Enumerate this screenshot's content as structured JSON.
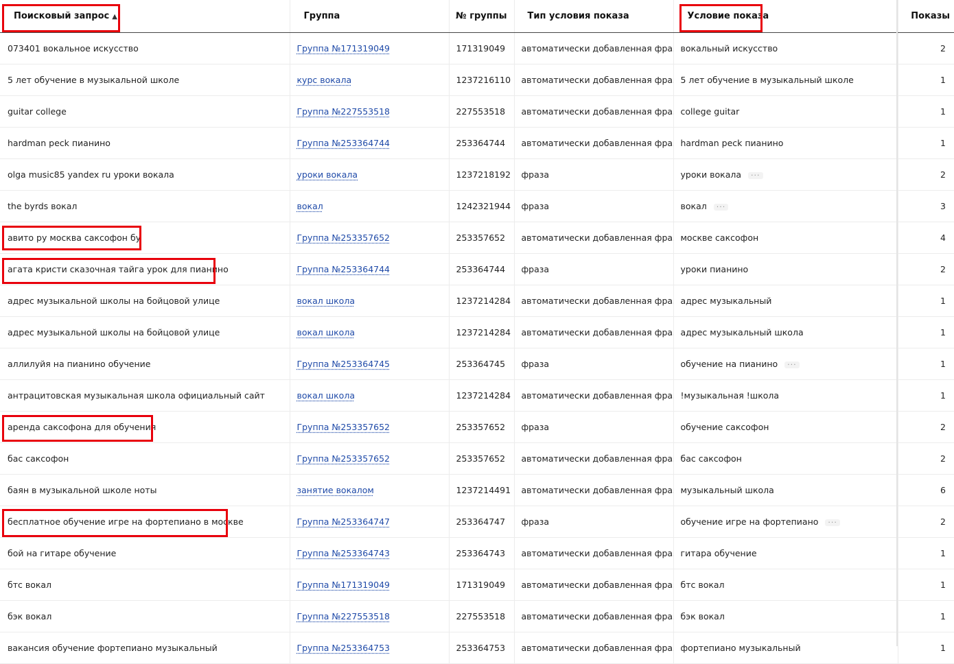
{
  "header": {
    "query": "Поисковый запрос",
    "sort_arrow": "▲",
    "group": "Группа",
    "group_number": "№ группы",
    "condition_type": "Тип условия показа",
    "condition": "Условие показа",
    "shows": "Показы"
  },
  "rows": [
    {
      "query": "073401 вокальное искусство",
      "group": "Группа №171319049",
      "group_number": "171319049",
      "type": "автоматически добавленная фраза",
      "condition": "вокальный искусство",
      "more": "",
      "shows": "2"
    },
    {
      "query": "5 лет обучение в музыкальной школе",
      "group": "курс вокала",
      "group_number": "1237216110",
      "type": "автоматически добавленная фраза",
      "condition": "5 лет обучение в музыкальный школе",
      "more": "",
      "shows": "1"
    },
    {
      "query": "guitar college",
      "group": "Группа №227553518",
      "group_number": "227553518",
      "type": "автоматически добавленная фраза",
      "condition": "college guitar",
      "more": "",
      "shows": "1"
    },
    {
      "query": "hardman peck пианино",
      "group": "Группа №253364744",
      "group_number": "253364744",
      "type": "автоматически добавленная фраза",
      "condition": "hardman peck пианино",
      "more": "",
      "shows": "1"
    },
    {
      "query": "olga music85 yandex ru уроки вокала",
      "group": "уроки вокала",
      "group_number": "1237218192",
      "type": "фраза",
      "condition": "уроки вокала",
      "more": "···",
      "shows": "2"
    },
    {
      "query": "the byrds вокал",
      "group": "вокал",
      "group_number": "1242321944",
      "type": "фраза",
      "condition": "вокал",
      "more": "···",
      "shows": "3"
    },
    {
      "query": "авито ру москва саксофон бу",
      "group": "Группа №253357652",
      "group_number": "253357652",
      "type": "автоматически добавленная фраза",
      "condition": "москве саксофон",
      "more": "",
      "shows": "4"
    },
    {
      "query": "агата кристи сказочная тайга урок для пианино",
      "group": "Группа №253364744",
      "group_number": "253364744",
      "type": "фраза",
      "condition": "уроки пианино",
      "more": "",
      "shows": "2"
    },
    {
      "query": "адрес музыкальной школы на бойцовой улице",
      "group": "вокал школа",
      "group_number": "1237214284",
      "type": "автоматически добавленная фраза",
      "condition": "адрес музыкальный",
      "more": "",
      "shows": "1"
    },
    {
      "query": "адрес музыкальной школы на бойцовой улице",
      "group": "вокал школа",
      "group_number": "1237214284",
      "type": "автоматически добавленная фраза",
      "condition": "адрес музыкальный школа",
      "more": "",
      "shows": "1"
    },
    {
      "query": "аллилуйя на пианино обучение",
      "group": "Группа №253364745",
      "group_number": "253364745",
      "type": "фраза",
      "condition": "обучение на пианино",
      "more": "···",
      "shows": "1"
    },
    {
      "query": "антрацитовская музыкальная школа официальный сайт",
      "group": "вокал школа",
      "group_number": "1237214284",
      "type": "автоматически добавленная фраза",
      "condition": "!музыкальная !школа",
      "more": "",
      "shows": "1"
    },
    {
      "query": "аренда саксофона для обучения",
      "group": "Группа №253357652",
      "group_number": "253357652",
      "type": "фраза",
      "condition": "обучение саксофон",
      "more": "",
      "shows": "2"
    },
    {
      "query": "бас саксофон",
      "group": "Группа №253357652",
      "group_number": "253357652",
      "type": "автоматически добавленная фраза",
      "condition": "бас саксофон",
      "more": "",
      "shows": "2"
    },
    {
      "query": "баян в музыкальной школе ноты",
      "group": "занятие вокалом",
      "group_number": "1237214491",
      "type": "автоматически добавленная фраза",
      "condition": "музыкальный школа",
      "more": "",
      "shows": "6"
    },
    {
      "query": "бесплатное обучение игре на фортепиано в москве",
      "group": "Группа №253364747",
      "group_number": "253364747",
      "type": "фраза",
      "condition": "обучение игре на фортепиано",
      "more": "···",
      "shows": "2"
    },
    {
      "query": "бой на гитаре обучение",
      "group": "Группа №253364743",
      "group_number": "253364743",
      "type": "автоматически добавленная фраза",
      "condition": "гитара обучение",
      "more": "",
      "shows": "1"
    },
    {
      "query": "бтс вокал",
      "group": "Группа №171319049",
      "group_number": "171319049",
      "type": "автоматически добавленная фраза",
      "condition": "бтс вокал",
      "more": "",
      "shows": "1"
    },
    {
      "query": "бэк вокал",
      "group": "Группа №227553518",
      "group_number": "227553518",
      "type": "автоматически добавленная фраза",
      "condition": "бэк вокал",
      "more": "",
      "shows": "1"
    },
    {
      "query": "вакансия обучение фортепиано музыкальный",
      "group": "Группа №253364753",
      "group_number": "253364753",
      "type": "автоматически добавленная фраза",
      "condition": "фортепиано музыкальный",
      "more": "",
      "shows": "1"
    }
  ],
  "colors": {
    "highlight": "#e8000b",
    "link": "#1f4aa8"
  }
}
